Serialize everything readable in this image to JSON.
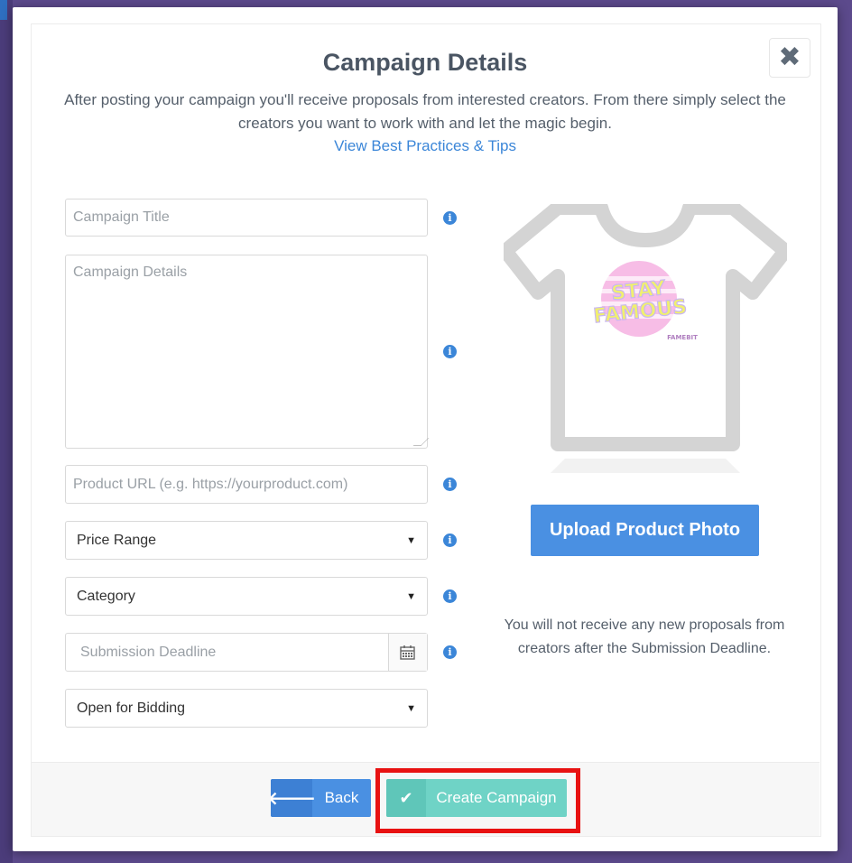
{
  "modal": {
    "title": "Campaign Details",
    "intro": "After posting your campaign you'll receive proposals from interested creators. From there simply select the creators you want to work with and let the magic begin.",
    "tips_link": "View Best Practices & Tips",
    "close_icon": "close-icon"
  },
  "form": {
    "campaign_title_placeholder": "Campaign Title",
    "campaign_details_placeholder": "Campaign Details",
    "product_url_placeholder": "Product URL (e.g. https://yourproduct.com)",
    "price_range": "Price Range",
    "category": "Category",
    "submission_deadline_placeholder": "Submission Deadline",
    "bidding_status": "Open for Bidding"
  },
  "preview": {
    "print_text_line1": "STAY",
    "print_text_line2": "FAMOUS",
    "print_brand": "FAMEBIT",
    "upload_label": "Upload Product Photo",
    "deadline_note": "You will not receive any new proposals from creators after the Submission Deadline."
  },
  "footer": {
    "back_label": "Back",
    "create_label": "Create Campaign"
  },
  "colors": {
    "primary": "#4a90e2",
    "success": "#6fd3c6",
    "highlight": "#e81212",
    "backdrop": "#5c4a8c"
  }
}
